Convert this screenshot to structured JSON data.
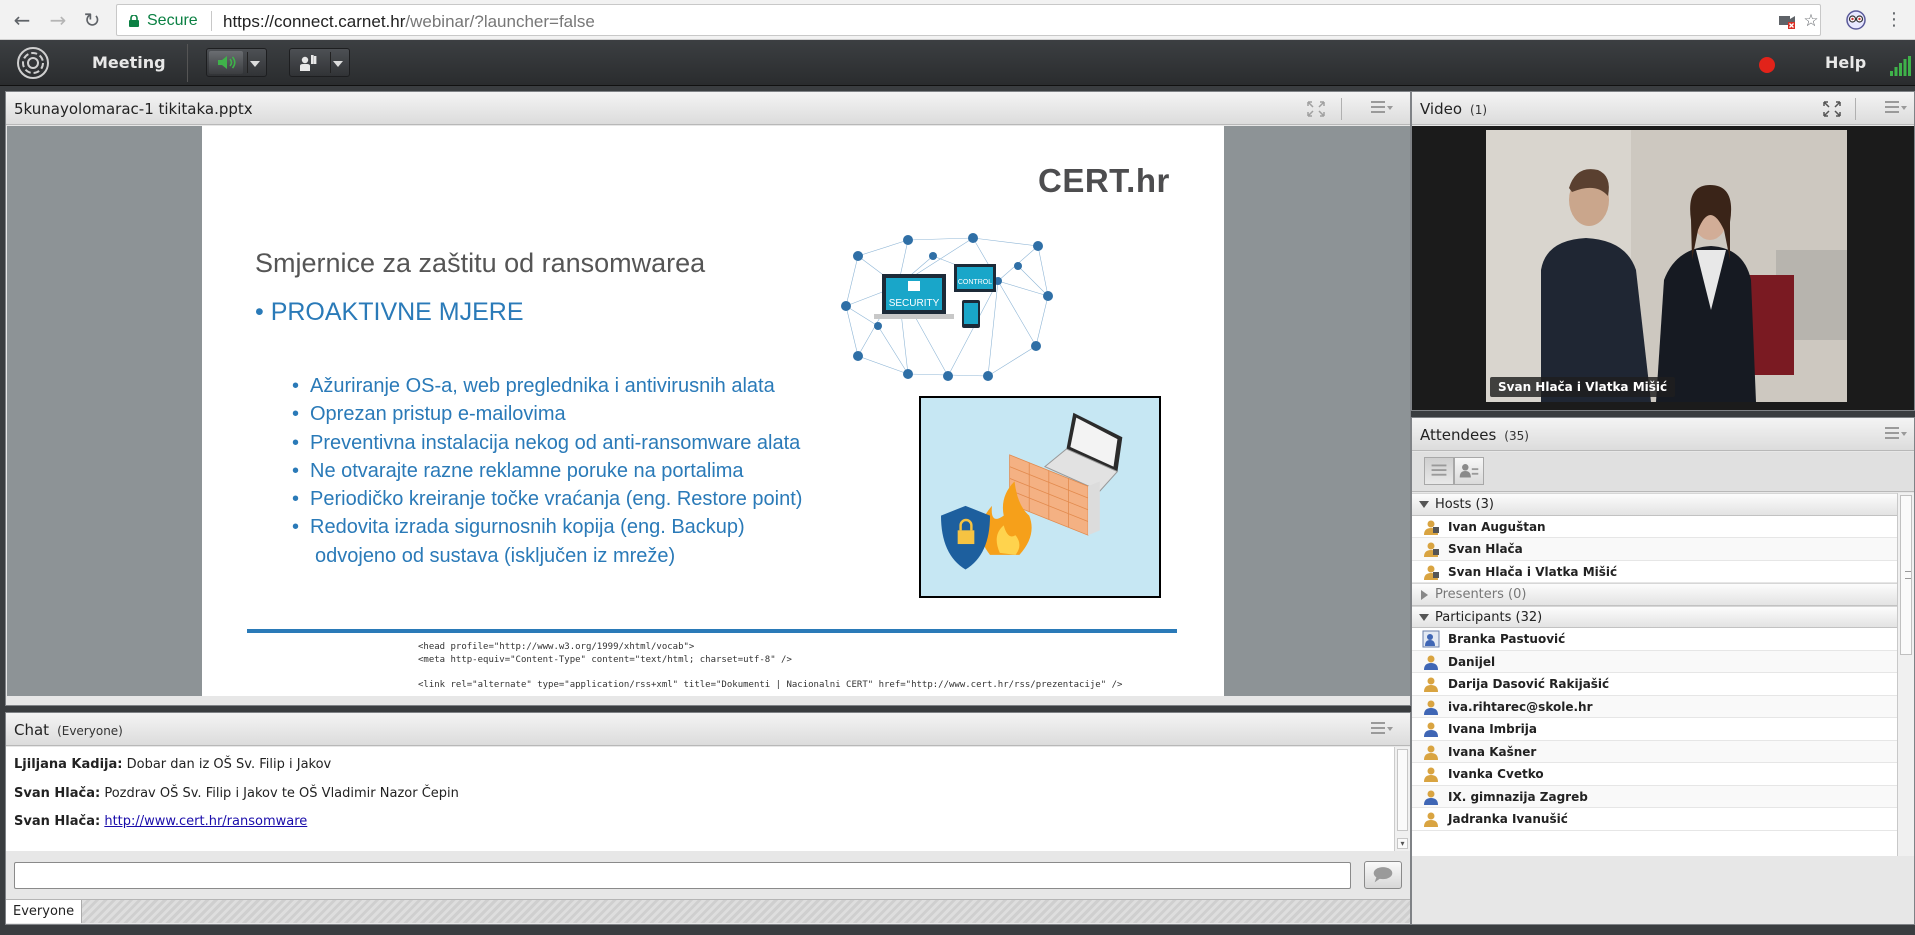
{
  "browser": {
    "secure_label": "Secure",
    "url_host": "https://connect.carnet.hr",
    "url_path": "/webinar/?launcher=false"
  },
  "header": {
    "meeting_label": "Meeting",
    "help_label": "Help",
    "colors": {
      "mic_active": "#3fb24a",
      "record": "#e2231a",
      "signal": "#3fb24a"
    }
  },
  "share": {
    "title": "5kunayolomarac-1 tikitaka.pptx",
    "slide": {
      "logo_text": "CERT.hr",
      "title": "Smjernice za zaštitu od ransomwarea",
      "subtitle": "PROAKTIVNE MJERE",
      "bullets": [
        "Ažuriranje OS-a, web preglednika i antivirusnih alata",
        "Oprezan pristup e-mailovima",
        "Preventivna instalacija nekog od anti-ransomware alata",
        "Ne otvarajte razne reklamne poruke na portalima",
        "Periodičko kreiranje točke vraćanja (eng. Restore point)",
        "Redovita izrada sigurnosnih kopija (eng. Backup)"
      ],
      "bullet_continuation": "odvojeno od sustava (isključen iz mreže)",
      "illus_labels": {
        "security": "SECURITY",
        "control": "CONTROL"
      },
      "code_lines": [
        "<head profile=\"http://www.w3.org/1999/xhtml/vocab\">",
        "<meta http-equiv=\"Content-Type\" content=\"text/html; charset=utf-8\" />",
        "",
        "<link rel=\"alternate\" type=\"application/rss+xml\" title=\"Dokumenti | Nacionalni CERT\" href=\"http://www.cert.hr/rss/prezentacije\" />"
      ]
    }
  },
  "chat": {
    "title": "Chat",
    "scope": "(Everyone)",
    "messages": [
      {
        "sender": "Ljiljana Kadija:",
        "text": "Dobar dan iz OŠ Sv. Filip i Jakov"
      },
      {
        "sender": "Svan Hlača:",
        "text": "Pozdrav OŠ Sv. Filip i Jakov te OŠ Vladimir Nazor Čepin"
      },
      {
        "sender": "Svan Hlača:",
        "link": "http://www.cert.hr/ransomware"
      }
    ],
    "tab_label": "Everyone"
  },
  "video": {
    "title": "Video",
    "count": "(1)",
    "caption": "Svan Hlača i Vlatka Mišić"
  },
  "attendees": {
    "title": "Attendees",
    "count": "(35)",
    "groups": {
      "hosts": {
        "label": "Hosts (3)",
        "members": [
          "Ivan Auguštan",
          "Svan Hlača",
          "Svan Hlača i Vlatka Mišić"
        ]
      },
      "presenters": {
        "label": "Presenters (0)"
      },
      "participants": {
        "label": "Participants (32)",
        "members": [
          "Branka Pastuović",
          "Danijel",
          "Darija Dasović Rakijašić",
          "iva.rihtarec@skole.hr",
          "Ivana Imbrija",
          "Ivana Kašner",
          "Ivanka Cvetko",
          "IX. gimnazija Zagreb",
          "Jadranka Ivanušić"
        ]
      }
    }
  }
}
